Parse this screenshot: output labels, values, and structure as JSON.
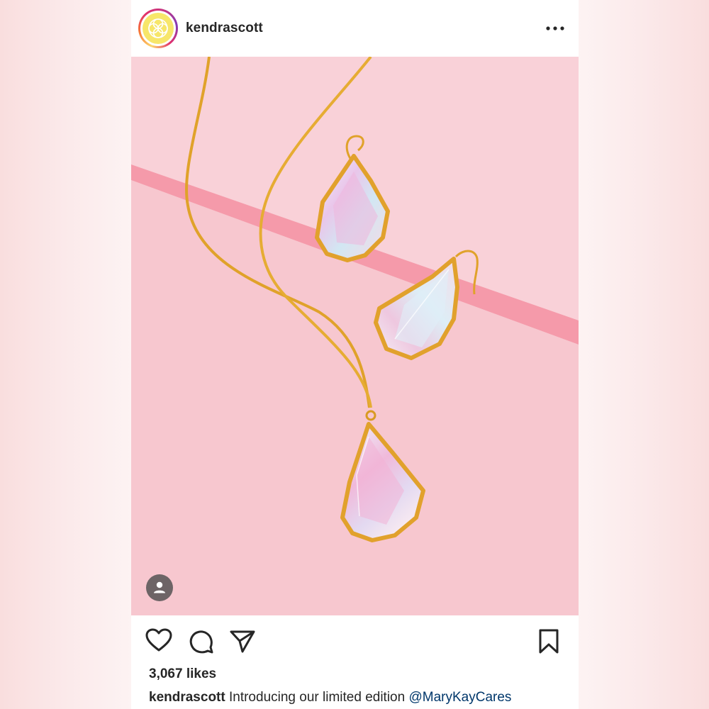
{
  "post": {
    "username": "kendrascott",
    "likes": "3,067 likes",
    "caption": {
      "username": "kendrascott",
      "text": "Introducing our limited edition",
      "mention": "@MaryKayCares"
    }
  },
  "icons": {
    "more": "more-options-icon",
    "like": "heart-icon",
    "comment": "comment-icon",
    "share": "send-icon",
    "save": "bookmark-icon",
    "tagged": "person-icon"
  },
  "colors": {
    "accent_pink": "#f8c6cf",
    "gold": "#e3a72f",
    "text": "#262626",
    "mention": "#00376b",
    "logo_yellow": "#f7e66a"
  }
}
